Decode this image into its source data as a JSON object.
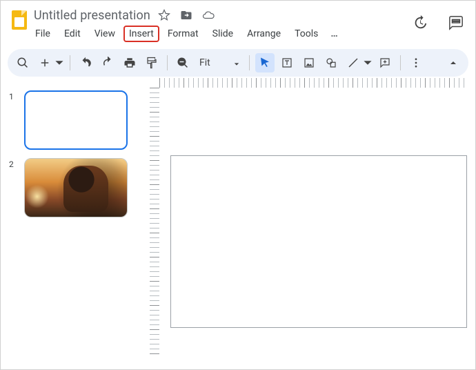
{
  "title": "Untitled presentation",
  "menus": {
    "file": "File",
    "edit": "Edit",
    "view": "View",
    "insert": "Insert",
    "format": "Format",
    "slide": "Slide",
    "arrange": "Arrange",
    "tools": "Tools",
    "more": "…"
  },
  "highlighted_menu": "insert",
  "toolbar": {
    "zoom_label": "Fit"
  },
  "strip": [
    {
      "number": "1",
      "selected": true,
      "kind": "blank"
    },
    {
      "number": "2",
      "selected": false,
      "kind": "image"
    }
  ],
  "icons": {
    "star": "star-outline",
    "move": "move-to-folder",
    "cloud": "cloud-done"
  }
}
